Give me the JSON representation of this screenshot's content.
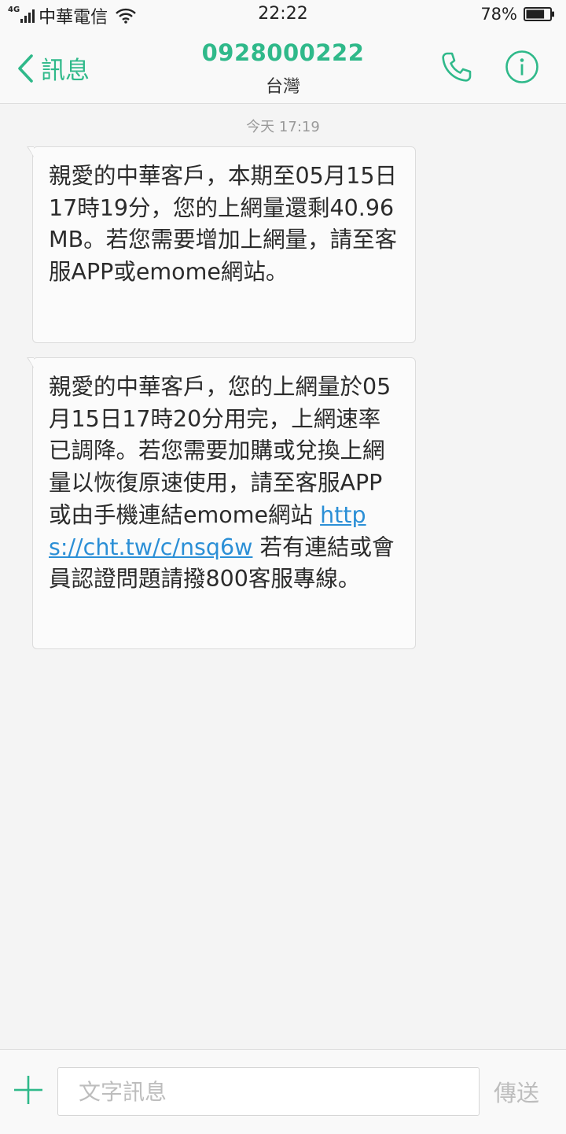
{
  "status_bar": {
    "network": "4G",
    "carrier": "中華電信",
    "time": "22:22",
    "battery": "78%",
    "battery_level": 0.78,
    "icons": [
      "signal-icon",
      "wifi-icon",
      "battery-icon"
    ]
  },
  "header": {
    "back_label": "訊息",
    "contact_number": "0928000222",
    "contact_region": "台灣",
    "icons": [
      "back-chevron-icon",
      "phone-icon",
      "info-icon"
    ]
  },
  "conversation": {
    "timestamp": "今天 17:19",
    "messages": [
      {
        "text": "親愛的中華客戶，本期至05月15日17時19分，您的上網量還剩40.96MB。若您需要增加上網量，請至客服APP或emome網站。"
      },
      {
        "text_before_link": "親愛的中華客戶，您的上網量於05月15日17時20分用完，上網速率已調降。若您需要加購或兌換上網量以恢復原速使用，請至客服APP或由手機連結emome網站",
        "link": "https://cht.tw/c/nsq6w",
        "text_after_link": "若有連結或會員認證問題請撥800客服專線。"
      }
    ]
  },
  "input_bar": {
    "placeholder": "文字訊息",
    "send_label": "傳送",
    "icons": [
      "plus-icon"
    ]
  },
  "colors": {
    "accent": "#2fb98a",
    "link": "#2b8fd6",
    "background": "#f4f4f4",
    "bubble": "#fbfbfb"
  }
}
